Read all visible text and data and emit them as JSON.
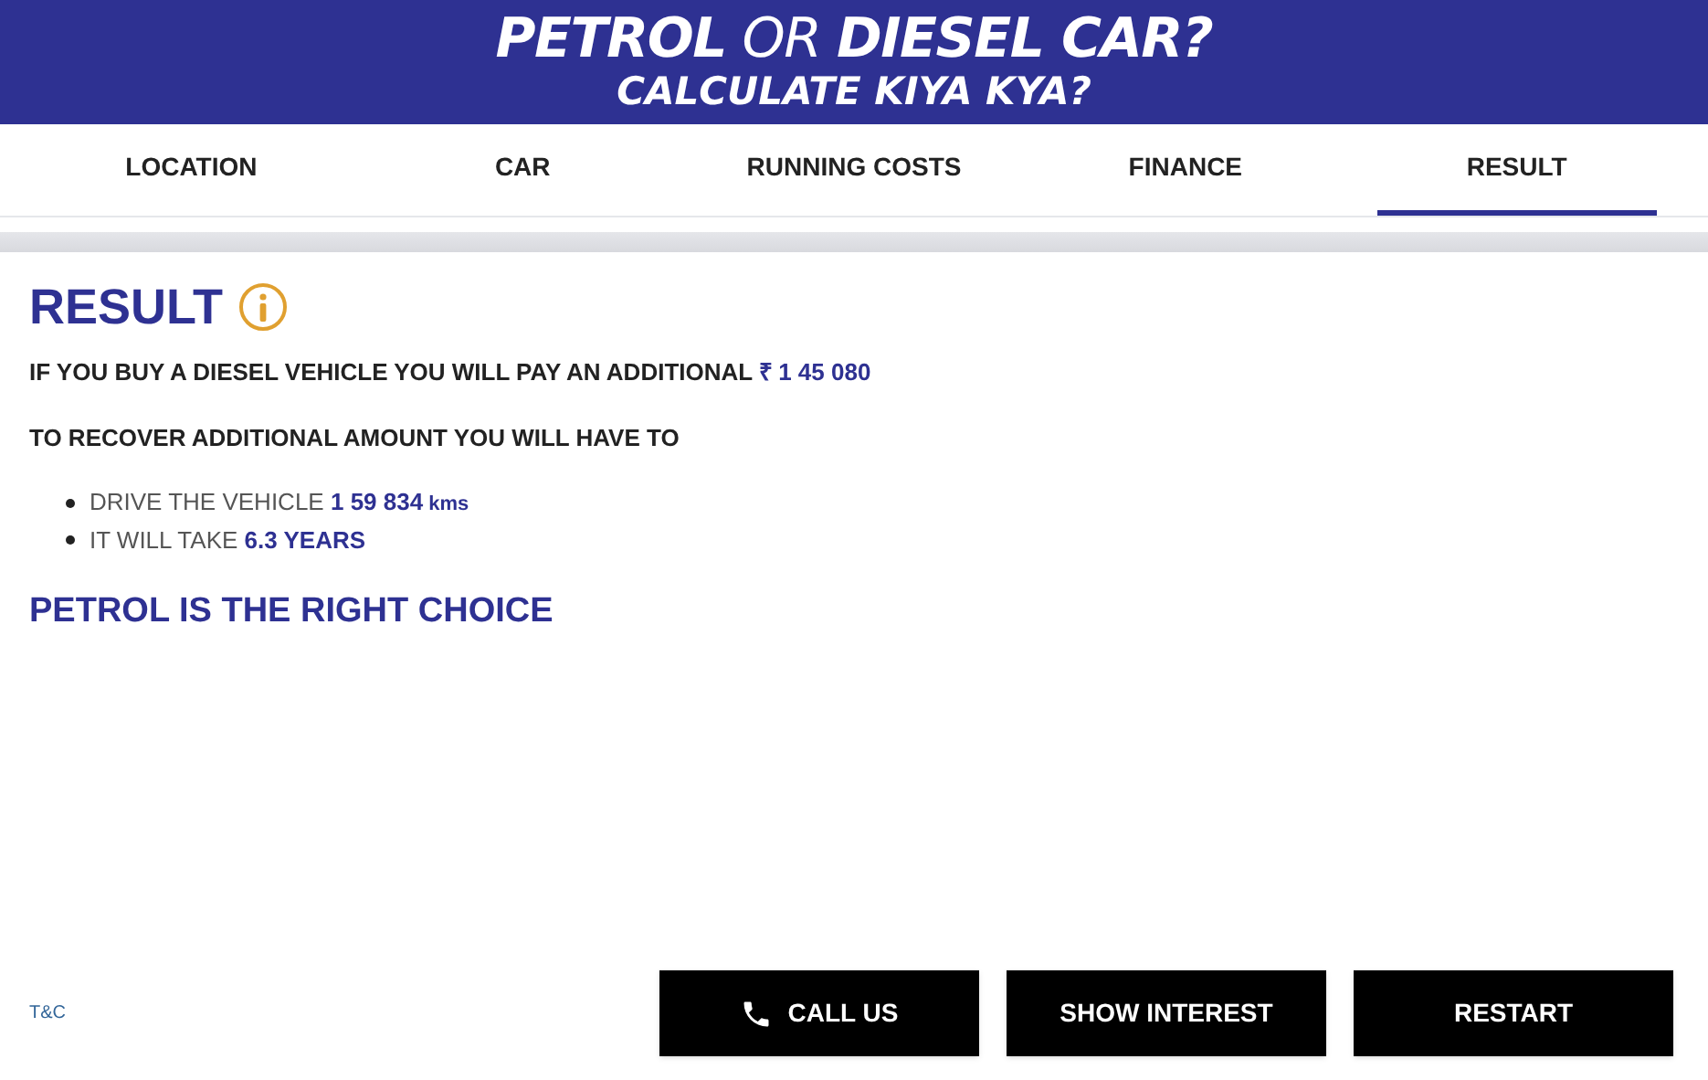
{
  "banner": {
    "title": "**PETROL** OR **DIESEL CAR?**",
    "subtitle": "CALCULATE KIYA KYA?"
  },
  "tabs": [
    {
      "label": "LOCATION",
      "selected": false
    },
    {
      "label": "CAR",
      "selected": false
    },
    {
      "label": "RUNNING COSTS",
      "selected": false
    },
    {
      "label": "FINANCE",
      "selected": false
    },
    {
      "label": "RESULT",
      "selected": true
    }
  ],
  "result": {
    "heading": "RESULT",
    "summary": {
      "text": "IF YOU BUY A DIESEL VEHICLE YOU WILL PAY AN ADDITIONAL",
      "value": "₹ 1 45 080"
    },
    "recover": "TO RECOVER ADDITIONAL AMOUNT YOU WILL HAVE TO",
    "points": [
      {
        "text": "DRIVE THE VEHICLE",
        "value": "1 59 834",
        "unit": "kms"
      },
      {
        "text": "IT WILL TAKE",
        "value": "6.3 YEARS"
      }
    ],
    "verdict": "PETROL IS THE RIGHT CHOICE"
  },
  "footer": {
    "link": "T&C",
    "buttons": [
      {
        "label": "CALL US",
        "kind": "call"
      },
      {
        "label": "SHOW INTEREST",
        "kind": "plain"
      },
      {
        "label": "RESTART",
        "kind": "plain"
      }
    ]
  }
}
